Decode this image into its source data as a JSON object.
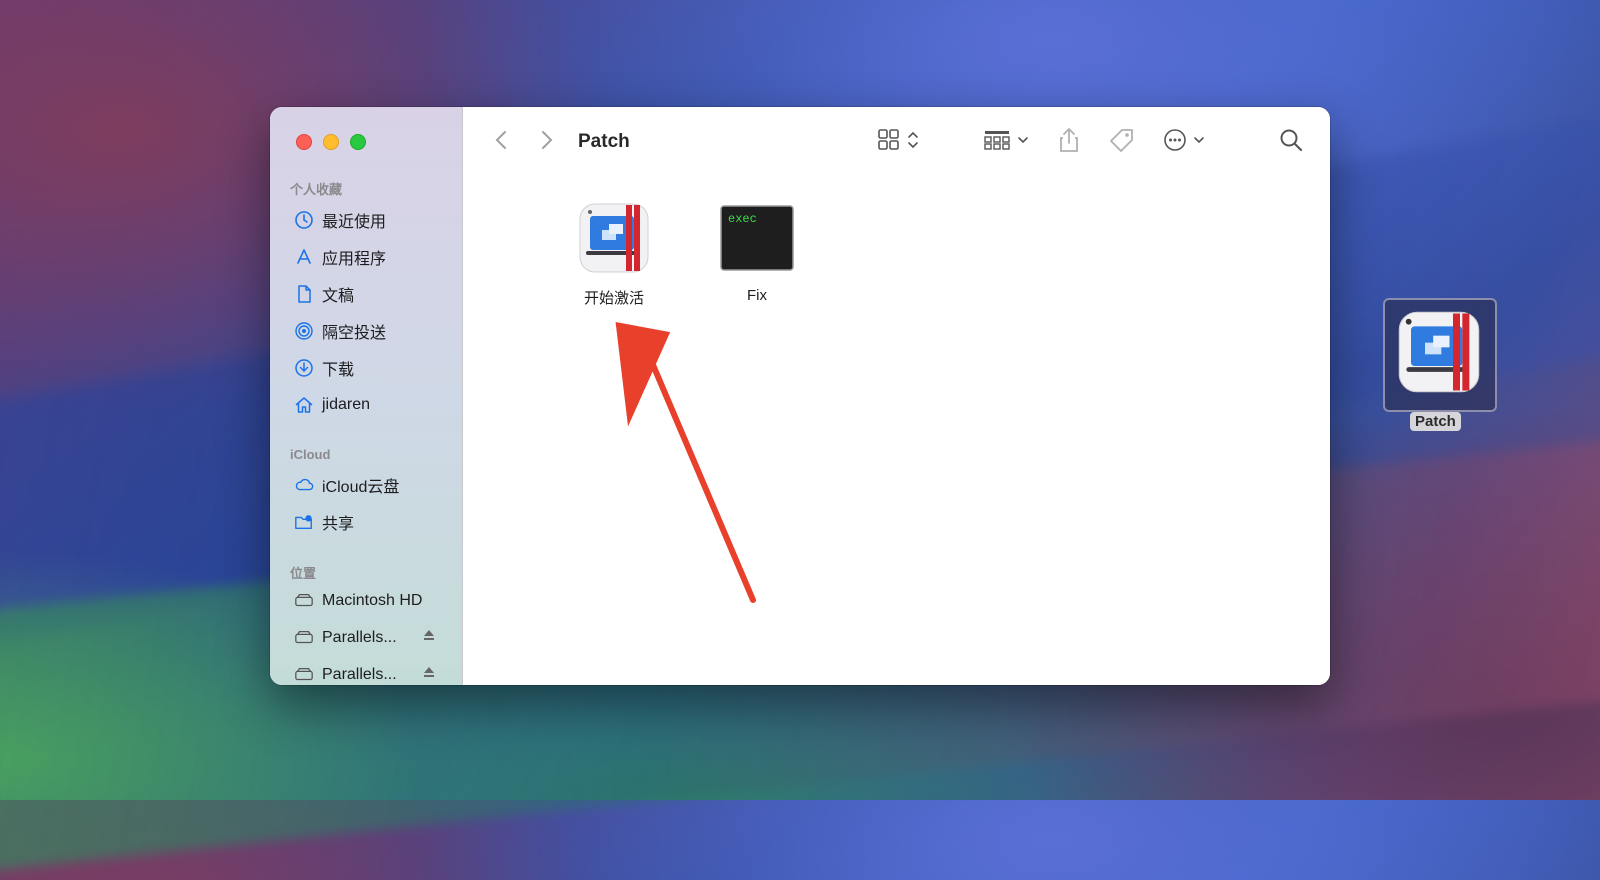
{
  "window": {
    "title": "Patch"
  },
  "sidebar": {
    "sections": [
      {
        "header": "个人收藏",
        "items": [
          {
            "label": "最近使用",
            "icon": "clock-icon"
          },
          {
            "label": "应用程序",
            "icon": "applications-icon"
          },
          {
            "label": "文稿",
            "icon": "document-icon"
          },
          {
            "label": "隔空投送",
            "icon": "airdrop-icon"
          },
          {
            "label": "下载",
            "icon": "download-icon"
          },
          {
            "label": "jidaren",
            "icon": "home-icon"
          }
        ]
      },
      {
        "header": "iCloud",
        "items": [
          {
            "label": "iCloud云盘",
            "icon": "cloud-icon"
          },
          {
            "label": "共享",
            "icon": "shared-folder-icon"
          }
        ]
      },
      {
        "header": "位置",
        "items": [
          {
            "label": "Macintosh HD",
            "icon": "disk-icon"
          },
          {
            "label": "Parallels...",
            "icon": "disk-icon",
            "eject": true
          },
          {
            "label": "Parallels...",
            "icon": "disk-icon",
            "eject": true
          }
        ]
      }
    ]
  },
  "files": [
    {
      "name": "开始激活",
      "icon": "parallels-app-icon"
    },
    {
      "name": "Fix",
      "icon": "terminal-exec-icon",
      "icon_text": "exec"
    }
  ],
  "desktop": {
    "icon_label": "Patch"
  },
  "colors": {
    "accent": "#1a73e8",
    "arrow": "#e8402a",
    "parallels_red": "#d4262e",
    "exec_green": "#3fdc4a"
  }
}
